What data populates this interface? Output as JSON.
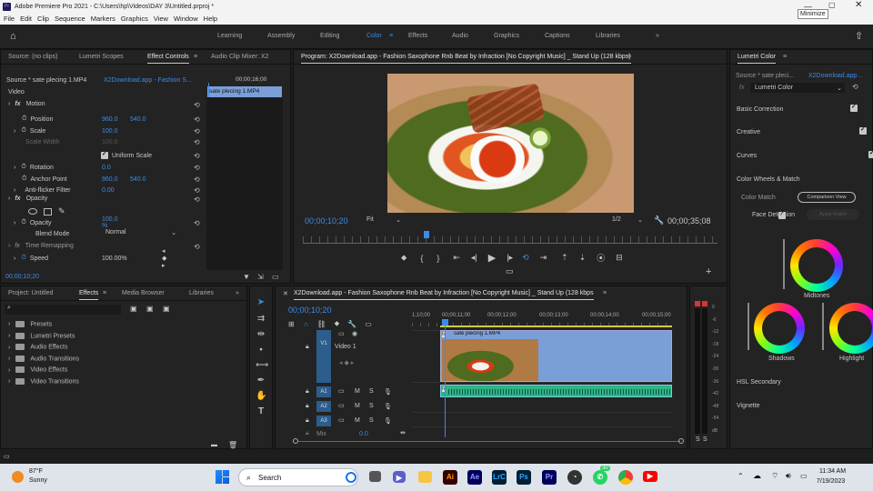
{
  "titlebar": {
    "title": "Adobe Premiere Pro 2021 - C:\\Users\\hp\\Videos\\DAY 3\\Untitled.prproj *",
    "tooltip": "Minimize"
  },
  "menu": [
    "File",
    "Edit",
    "Clip",
    "Sequence",
    "Markers",
    "Graphics",
    "View",
    "Window",
    "Help"
  ],
  "workspaces": [
    "Learning",
    "Assembly",
    "Editing",
    "Color",
    "Effects",
    "Audio",
    "Graphics",
    "Captions",
    "Libraries"
  ],
  "active_workspace": "Color",
  "source_panel": {
    "tabs": [
      "Source: (no clips)",
      "Lumetri Scopes",
      "Effect Controls",
      "Audio Clip Mixer: X2"
    ],
    "active": "Effect Controls"
  },
  "effect_controls": {
    "source": "Source * sate plecing 1.MP4",
    "sequence": "X2Download.app - Fashion S...",
    "timecode_top": "00;00;16;00",
    "clip_label": "sate plecing 1.MP4",
    "video_label": "Video",
    "motion": "Motion",
    "rows": [
      {
        "label": "Position",
        "v1": "960.0",
        "v2": "540.0"
      },
      {
        "label": "Scale",
        "v1": "100.0",
        "v2": ""
      },
      {
        "label": "Scale Width",
        "v1": "100.0",
        "v2": ""
      },
      {
        "label": "Uniform Scale",
        "v1": "",
        "v2": ""
      },
      {
        "label": "Rotation",
        "v1": "0.0",
        "v2": ""
      },
      {
        "label": "Anchor Point",
        "v1": "960.0",
        "v2": "540.0"
      },
      {
        "label": "Anti-flicker Filter",
        "v1": "0.00",
        "v2": ""
      }
    ],
    "opacity": "Opacity",
    "opacity_row": {
      "label": "Opacity",
      "v1": "100.0 %"
    },
    "blend_label": "Blend Mode",
    "blend_value": "Normal",
    "time_remap": "Time Remapping",
    "speed_label": "Speed",
    "speed_value": "100.00%",
    "timecode_bottom": "00;00;10;20"
  },
  "program": {
    "title": "Program: X2Download.app - Fashion Saxophone Rnb Beat by Infraction [No Copyright Music] _ Stand Up (128 kbps)",
    "timecode": "00;00;10;20",
    "fit": "Fit",
    "res": "1/2",
    "duration": "00;00;35;08"
  },
  "lumetri": {
    "title": "Lumetri Color",
    "source": "Source * sate pleci...",
    "seq": "X2Download.app...",
    "fx": "Lumetri Color",
    "sections": [
      "Basic Correction",
      "Creative",
      "Curves",
      "Color Wheels & Match"
    ],
    "color_match": "Color Match",
    "comparison": "Comparison View",
    "face": "Face Detection",
    "apply": "Apply Match",
    "wheels": [
      "Midtones",
      "Shadows",
      "Highlight"
    ],
    "hsl": "HSL Secondary",
    "vignette": "Vignette"
  },
  "project": {
    "tabs": [
      "Project: Untitled",
      "Effects",
      "Media Browser",
      "Libraries"
    ],
    "active": "Effects",
    "items": [
      "Presets",
      "Lumetri Presets",
      "Audio Effects",
      "Audio Transitions",
      "Video Effects",
      "Video Transitions"
    ]
  },
  "timeline": {
    "title": "X2Download.app - Fashion Saxophone Rnb Beat by Infraction [No Copyright Music] _ Stand Up (128 kbps",
    "timecode": "00;00;10;20",
    "ruler": [
      "1;10;00",
      "00;00;11;00",
      "00;00;12;00",
      "00;00;13;00",
      "00;00;14;00",
      "00;00;15;00"
    ],
    "clip": "sate plecing 1.MP4",
    "v1": "V1",
    "video1": "Video 1",
    "a1": "A1",
    "a2": "A2",
    "a3": "A3",
    "mix": "Mix",
    "mix_val": "0.0"
  },
  "meter": {
    "ticks": [
      "0",
      "-6",
      "-12",
      "-18",
      "-24",
      "-30",
      "-36",
      "-42",
      "-48",
      "-54",
      "dB"
    ],
    "solo": [
      "S",
      "S"
    ]
  },
  "taskbar": {
    "temp": "87°F",
    "weather": "Sunny",
    "search": "Search",
    "time": "11:34 AM",
    "date": "7/19/2023",
    "badge": "30"
  },
  "colors": {
    "accent": "#3b8be8",
    "clip_video": "#7a9ed8",
    "clip_audio": "#2fb388",
    "track_blue": "#2b5d8d"
  }
}
